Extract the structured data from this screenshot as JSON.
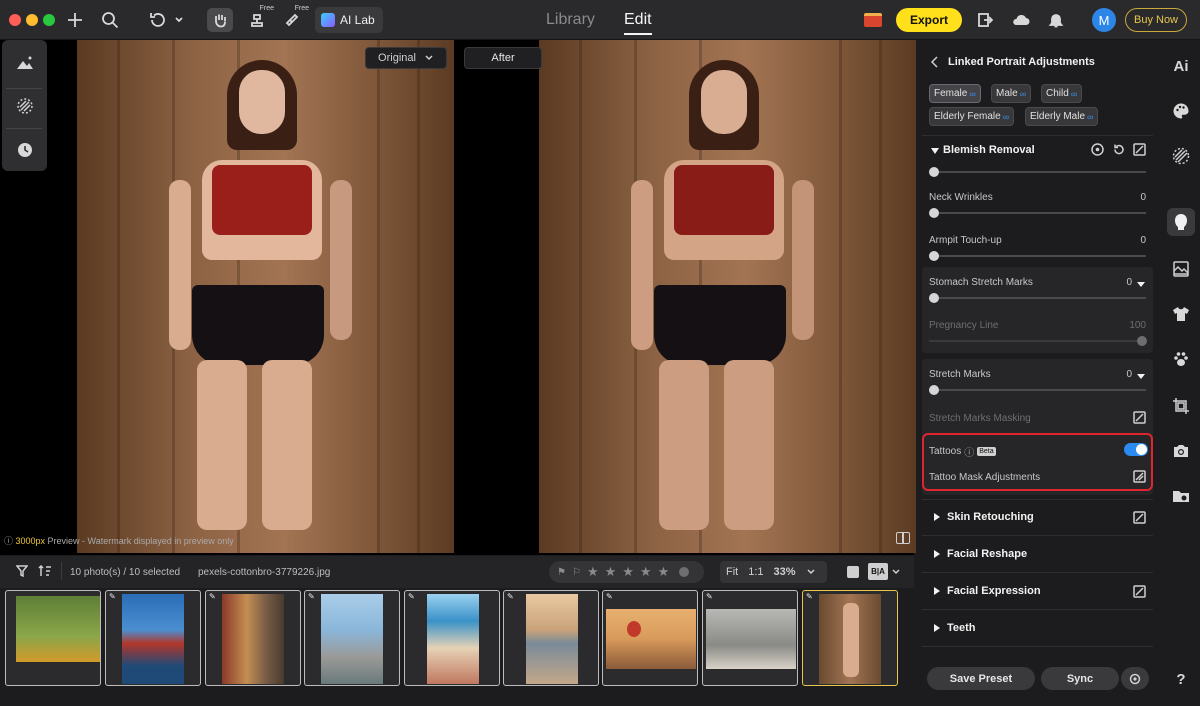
{
  "topbar": {
    "free_label_1": "Free",
    "free_label_2": "Free",
    "ailab_label": "AI Lab",
    "tab_library": "Library",
    "tab_edit": "Edit",
    "export_label": "Export",
    "avatar_initial": "M",
    "buy_now_label": "Buy Now"
  },
  "canvas": {
    "original_label": "Original",
    "after_label": "After",
    "watermark_size": "3000px",
    "watermark_text": " Preview - Watermark displayed in preview only"
  },
  "filmbar": {
    "count_text": "10 photo(s) / 10 selected",
    "filename": "pexels-cottonbro-3779226.jpg",
    "fit_label": "Fit",
    "oneone_label": "1:1",
    "zoom_value": "33%",
    "ba_label": "B|A"
  },
  "filmstrip": {
    "thumb_colors": [
      "#6d8a3e",
      "#2b6fb3",
      "#8a6a4a",
      "#8fb8da",
      "#4f9ac8",
      "#c9a27a",
      "#b8824e",
      "#9a9a96",
      "#8a6443"
    ]
  },
  "panel": {
    "title": "Linked Portrait Adjustments",
    "chips_row1": [
      "Female",
      "Male",
      "Child"
    ],
    "chips_row2": [
      "Elderly Female",
      "Elderly Male"
    ],
    "blemish_title": "Blemish Removal",
    "sliders": {
      "neck_label": "Neck Wrinkles",
      "neck_value": "0",
      "armpit_label": "Armpit Touch-up",
      "armpit_value": "0",
      "stomach_label": "Stomach Stretch Marks",
      "stomach_value": "0",
      "pregnancy_label": "Pregnancy Line",
      "pregnancy_value": "100",
      "stretch_label": "Stretch Marks",
      "stretch_value": "0",
      "stretch_mask_label": "Stretch Marks Masking"
    },
    "tattoos_label": "Tattoos",
    "beta_label": "Beta",
    "tattoo_mask_label": "Tattoo Mask Adjustments",
    "tattoos_enabled": true,
    "sections": [
      "Skin Retouching",
      "Facial Reshape",
      "Facial Expression",
      "Teeth"
    ],
    "save_preset_label": "Save Preset",
    "sync_label": "Sync",
    "help_label": "?"
  },
  "rail": {
    "ai_label": "Ai"
  }
}
